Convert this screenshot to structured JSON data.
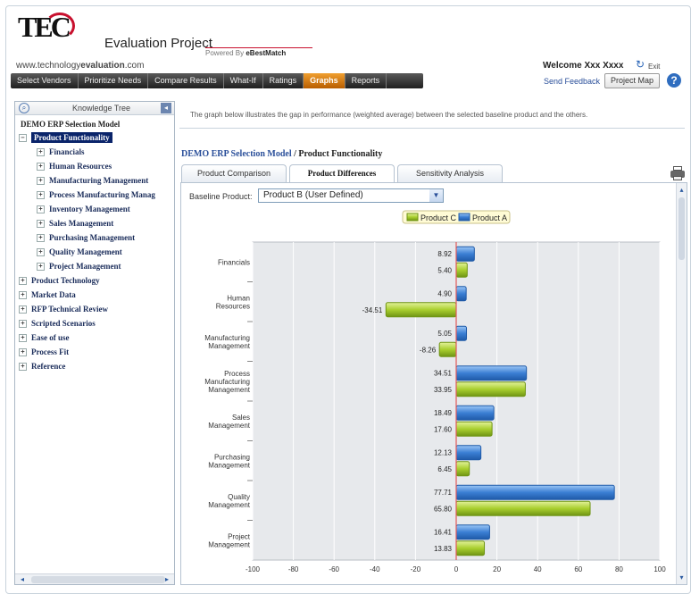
{
  "header": {
    "logo_text": "TEC",
    "app_title": "Evaluation Project",
    "powered_by_prefix": "Powered By ",
    "powered_by_brand": "eBestMatch",
    "site_prefix": "www.technology",
    "site_bold": "evaluation",
    "site_suffix": ".com",
    "welcome": "Welcome Xxx Xxxx",
    "exit_label": "Exit"
  },
  "nav": {
    "items": [
      "Select Vendors",
      "Prioritize Needs",
      "Compare Results",
      "What-If",
      "Ratings",
      "Graphs",
      "Reports"
    ],
    "active": "Graphs",
    "send_feedback": "Send Feedback",
    "project_map": "Project Map",
    "help": "?"
  },
  "sidebar": {
    "title": "Knowledge Tree",
    "model": "DEMO ERP Selection Model",
    "selected": "Product Functionality",
    "sub_items": [
      "Financials",
      "Human Resources",
      "Manufacturing Management",
      "Process Manufacturing Manag",
      "Inventory Management",
      "Sales Management",
      "Purchasing Management",
      "Quality Management",
      "Project Management"
    ],
    "top_items": [
      "Product Technology",
      "Market Data",
      "RFP Technical Review",
      "Scripted Scenarios",
      "Ease of use",
      "Process Fit",
      "Reference"
    ],
    "expand_glyph": "+",
    "collapse_glyph": "−"
  },
  "main": {
    "description": "The graph below illustrates the gap in performance (weighted average) between the selected baseline product and the others.",
    "breadcrumb_model": "DEMO ERP Selection Model",
    "breadcrumb_sep": " / ",
    "breadcrumb_current": "Product Functionality",
    "tabs": [
      "Product Comparison",
      "Product Differences",
      "Sensitivity Analysis"
    ],
    "active_tab": "Product Differences",
    "baseline_label": "Baseline Product:",
    "baseline_value": "Product B (User Defined)"
  },
  "colors": {
    "product_a": "#3b7fd4",
    "product_c": "#a9cf2f",
    "zero_line": "#e05a5a",
    "plot_bg": "#e7e9ec",
    "accent_nav": "#d97a10"
  },
  "chart_data": {
    "type": "bar",
    "orientation": "horizontal",
    "categories": [
      "Financials",
      "Human Resources",
      "Manufacturing Management",
      "Process Manufacturing Management",
      "Sales Management",
      "Purchasing Management",
      "Quality Management",
      "Project Management"
    ],
    "series": [
      {
        "name": "Product A",
        "values": [
          8.92,
          4.9,
          5.05,
          34.51,
          18.49,
          12.13,
          77.71,
          16.41
        ]
      },
      {
        "name": "Product C",
        "values": [
          5.4,
          -34.51,
          -8.26,
          33.95,
          17.6,
          6.45,
          65.8,
          13.83
        ]
      }
    ],
    "legend_order": [
      "Product C",
      "Product A"
    ],
    "legend_placement": "top",
    "xlim": [
      -100,
      100
    ],
    "xticks": [
      -100,
      -80,
      -60,
      -40,
      -20,
      0,
      20,
      40,
      60,
      80,
      100
    ],
    "grid": true
  }
}
